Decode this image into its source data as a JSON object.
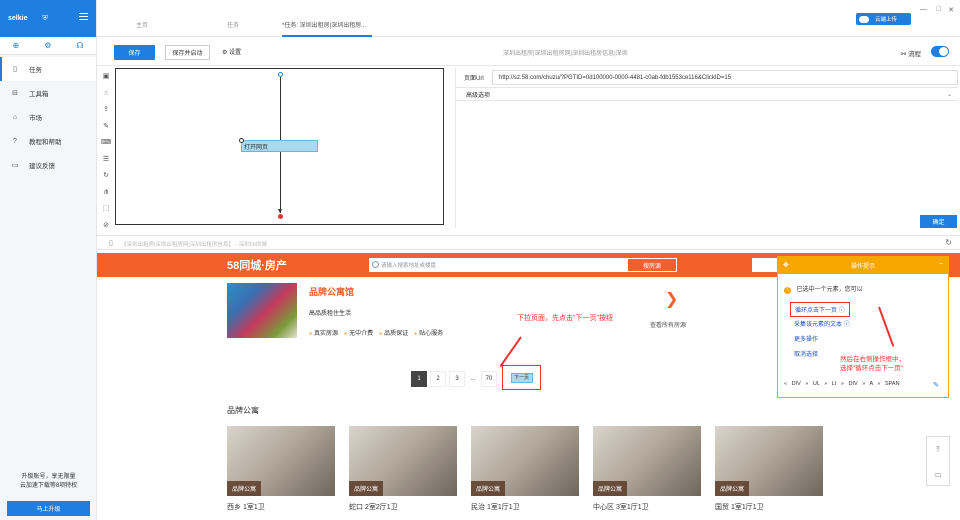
{
  "app": {
    "brand": "selkie",
    "shield_glyph": "⛨"
  },
  "sidebar": {
    "quick_icons": [
      "plus-circle-icon",
      "gear-icon",
      "headset-icon"
    ],
    "items": [
      {
        "label": "任务",
        "icon": "document-icon",
        "glyph": "▯"
      },
      {
        "label": "工具箱",
        "icon": "toolbox-icon",
        "glyph": "⊟"
      },
      {
        "label": "市场",
        "icon": "shop-icon",
        "glyph": "⌂"
      },
      {
        "label": "教程和帮助",
        "icon": "help-icon",
        "glyph": "?"
      },
      {
        "label": "建议反馈",
        "icon": "feedback-icon",
        "glyph": "▭"
      }
    ],
    "upgrade_text_1": "升级账号，享无限量",
    "upgrade_text_2": "云加速下载等8项特权",
    "upgrade_button": "马上升级"
  },
  "tabs": {
    "items": [
      "主页",
      "任务",
      "*任务: 深圳出租房|深圳出租房..."
    ],
    "cloud_upload": "云端上传",
    "window_controls": [
      "—",
      "□",
      "✕"
    ]
  },
  "toolbar": {
    "save": "保存",
    "save_run": "保存并启动",
    "settings": "设置",
    "title": "深圳出租房|深圳出租房网|深圳出租房信息|深圳",
    "flow": "流程"
  },
  "flow": {
    "step_label": "打开网页"
  },
  "props": {
    "url_label": "页面Url",
    "url_value": "http://sz.58.com/chuzu/?PGTID=0d100000-0000-4481-c0ab-fdb1553ce116&ClickID=15",
    "advanced": "高级选项",
    "confirm": "确定"
  },
  "browser": {
    "address": "【深圳出租房|深圳出租房网|深圳出租房信息】 - 深圳58同城"
  },
  "web": {
    "logo": "58同城·房产",
    "search_placeholder": "请输入搜索地址或楼盘",
    "search_button": "搜房源",
    "brand_title": "品牌公寓馆",
    "brand_slogan": "高品质租住生活",
    "tags": [
      "真实房源",
      "无中介费",
      "品质保证",
      "贴心服务"
    ],
    "view_all": "查看所有房源",
    "annotation_left": "下拉页面，先点击\"下一页\"按钮",
    "pages": [
      "1",
      "2",
      "3",
      "...",
      "70"
    ],
    "next_label": "下一页",
    "section_title": "品牌公寓",
    "cards": [
      {
        "badge": "品牌公寓",
        "caption": "西乡 1室1卫"
      },
      {
        "badge": "品牌公寓",
        "caption": "蛇口 2室2厅1卫"
      },
      {
        "badge": "品牌公寓",
        "caption": "民治 1室1厅1卫"
      },
      {
        "badge": "品牌公寓",
        "caption": "中心区 3室1厅1卫"
      },
      {
        "badge": "品牌公寓",
        "caption": "国贸 1室1厅1卫"
      }
    ]
  },
  "tips": {
    "header": "操作提示",
    "message": "已选中一个元素，您可以",
    "loop_next": "循环点击下一页",
    "collect_text": "采集该元素的文本",
    "more_ops": "更多操作",
    "cancel_select": "取消选择",
    "note_1": "然后在右侧操作框中，",
    "note_2": "选择\"循环点击下一页\"",
    "path": "« DIV » UL » LI » DIV » A » SPAN"
  }
}
